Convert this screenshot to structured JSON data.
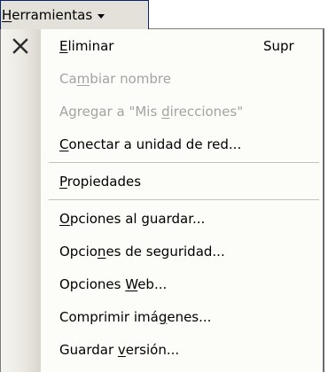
{
  "menu": {
    "title_accel": "H",
    "title_rest": "erramientas"
  },
  "items": [
    {
      "pre": "",
      "acc": "E",
      "post": "liminar",
      "shortcut": "Supr",
      "icon": "delete-x-icon",
      "disabled": false
    },
    {
      "pre": "Ca",
      "acc": "m",
      "post": "biar nombre",
      "shortcut": "",
      "disabled": true
    },
    {
      "pre": "Agregar a \"Mis ",
      "acc": "d",
      "post": "irecciones\"",
      "shortcut": "",
      "disabled": true
    },
    {
      "pre": "",
      "acc": "C",
      "post": "onectar a unidad de red...",
      "shortcut": "",
      "disabled": false
    },
    {
      "pre": "",
      "acc": "P",
      "post": "ropiedades",
      "shortcut": "",
      "disabled": false
    },
    {
      "pre": "",
      "acc": "O",
      "post": "pciones al guardar...",
      "shortcut": "",
      "disabled": false
    },
    {
      "pre": "Opcio",
      "acc": "n",
      "post": "es de seguridad...",
      "shortcut": "",
      "disabled": false
    },
    {
      "pre": "Opciones ",
      "acc": "W",
      "post": "eb...",
      "shortcut": "",
      "disabled": false
    },
    {
      "pre": "Comprimir imá",
      "acc": "g",
      "post": "enes...",
      "shortcut": "",
      "disabled": false
    },
    {
      "pre": "Guardar ",
      "acc": "v",
      "post": "ersión...",
      "shortcut": "",
      "disabled": false
    }
  ]
}
